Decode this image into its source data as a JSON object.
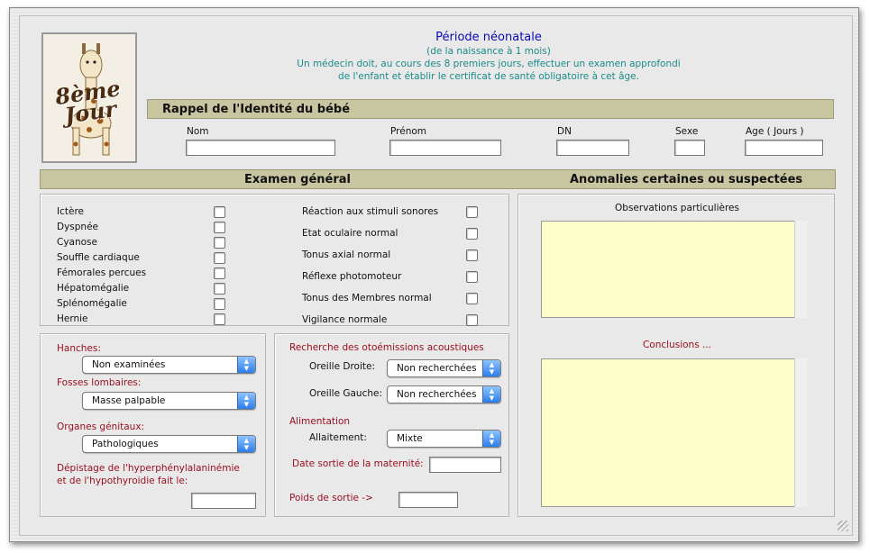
{
  "header": {
    "title": "Période néonatale",
    "line1": "(de la naissance à 1 mois)",
    "line2": "Un médecin doit, au cours des 8 premiers jours, effectuer un examen approfondi",
    "line3": "de l'enfant et établir le certificat de santé obligatoire à cet âge."
  },
  "logo": {
    "line1": "8ème",
    "line2": "Jour"
  },
  "identity": {
    "title": "Rappel de l'Identité du bébé",
    "nom_label": "Nom",
    "prenom_label": "Prénom",
    "dn_label": "DN",
    "sexe_label": "Sexe",
    "age_label": "Age ( Jours )",
    "nom_value": "",
    "prenom_value": "",
    "dn_value": "",
    "sexe_value": "",
    "age_value": ""
  },
  "sections": {
    "exam_title": "Examen général",
    "anomalies_title": "Anomalies certaines ou suspectées"
  },
  "exam_left": [
    "Ictère",
    "Dyspnée",
    "Cyanose",
    "Souffle cardiaque",
    "Fémorales percues",
    "Hépatomégalie",
    "Splénomégalie",
    "Hernie"
  ],
  "exam_right": [
    "Réaction aux stimuli sonores",
    "Etat oculaire normal",
    "Tonus axial normal",
    "Réflexe photomoteur",
    "Tonus des Membres normal",
    "Vigilance normale"
  ],
  "hips": {
    "hanches_label": "Hanches:",
    "hanches_value": "Non examinées",
    "fosses_label": "Fosses lombaires:",
    "fosses_value": "Masse palpable",
    "organes_label": "Organes génitaux:",
    "organes_value": "Pathologiques",
    "depistage_label1": "Dépistage de l'hyperphénylalaninémie",
    "depistage_label2": "et de l'hypothyroidie fait le:",
    "depistage_value": ""
  },
  "oto": {
    "title": "Recherche des otoémissions acoustiques",
    "droite_label": "Oreille Droite:",
    "droite_value": "Non recherchées",
    "gauche_label": "Oreille Gauche:",
    "gauche_value": "Non recherchées",
    "alimentation_label": "Alimentation",
    "allaitement_label": "Allaitement:",
    "allaitement_value": "Mixte",
    "sortie_label": "Date sortie de la maternité:",
    "sortie_value": "",
    "poids_label": "Poids de sortie ->",
    "poids_value": ""
  },
  "anomalies": {
    "observations_label": "Observations particulières",
    "conclusions_label": "Conclusions ..."
  },
  "colors": {
    "bar": "#c8c6a0",
    "title_blue": "#0a0ab8",
    "teal": "#1b8a8a",
    "label_red": "#9b1020",
    "note_yellow": "#ffffcc"
  }
}
